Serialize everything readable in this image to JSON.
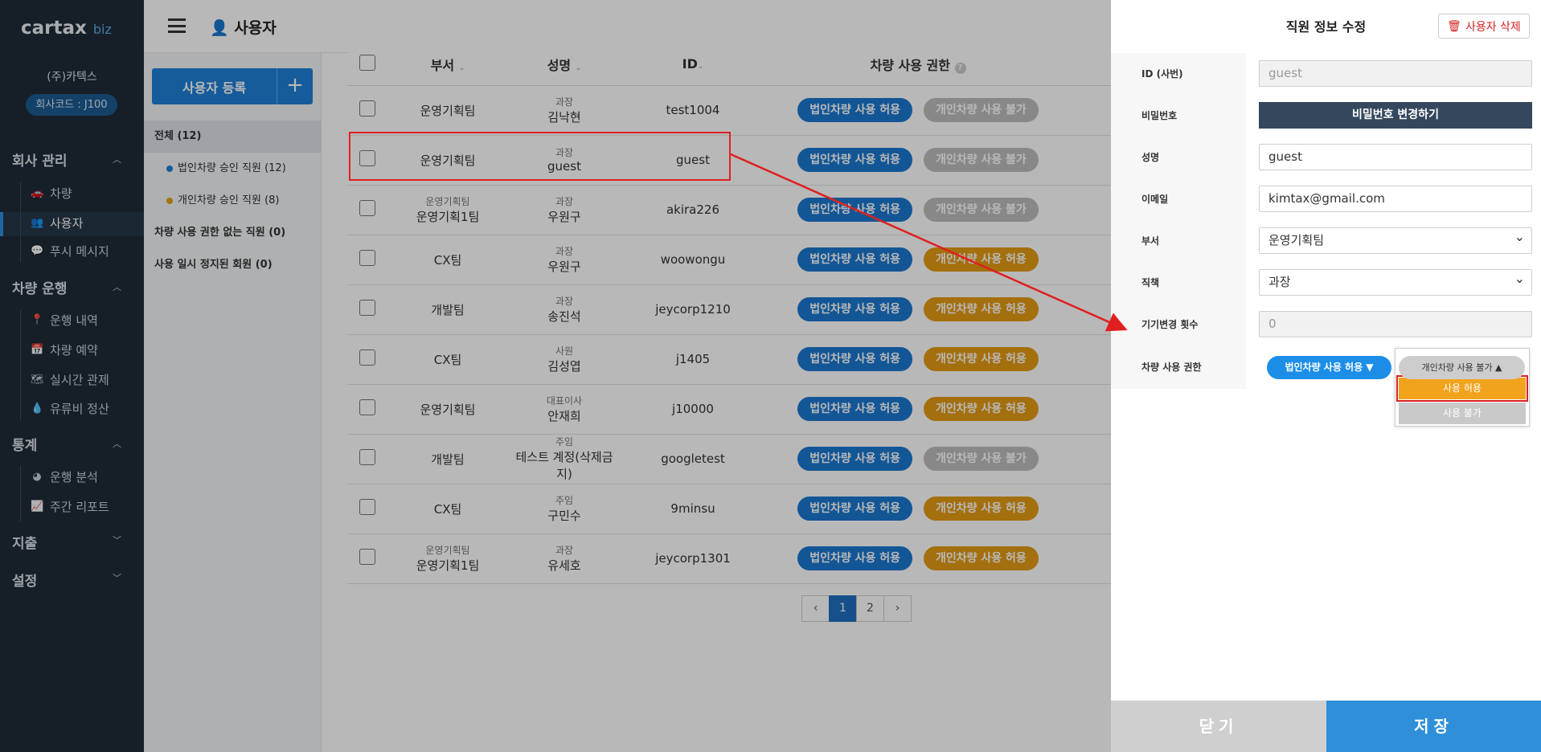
{
  "brand": {
    "logo": "cartax",
    "logo_suffix": "biz",
    "company": "(주)카텍스",
    "company_code": "회사코드 : J100"
  },
  "sidebar": {
    "sections": [
      {
        "label": "회사 관리",
        "items": [
          {
            "label": "차량",
            "icon": "car-icon"
          },
          {
            "label": "사용자",
            "icon": "user-icon"
          },
          {
            "label": "푸시 메시지",
            "icon": "message-icon"
          }
        ]
      },
      {
        "label": "차량 운행",
        "items": [
          {
            "label": "운행 내역",
            "icon": "map-pin-icon"
          },
          {
            "label": "차량 예약",
            "icon": "calendar-icon"
          },
          {
            "label": "실시간 관제",
            "icon": "map-icon"
          },
          {
            "label": "유류비 정산",
            "icon": "fuel-drop-icon"
          }
        ]
      },
      {
        "label": "통계",
        "items": [
          {
            "label": "운행 분석",
            "icon": "pie-chart-icon"
          },
          {
            "label": "주간 리포트",
            "icon": "area-chart-icon"
          }
        ]
      },
      {
        "label": "지출",
        "items": []
      },
      {
        "label": "설정",
        "items": []
      }
    ]
  },
  "header": {
    "title": "사용자"
  },
  "left_panel": {
    "register_button": "사용자 등록",
    "filters": [
      {
        "label": "전체 (12)"
      },
      {
        "label": "법인차량 승인 직원 (12)",
        "dot": "#1f7fd6"
      },
      {
        "label": "개인차량 승인 직원 (8)",
        "dot": "#e3a11a"
      },
      {
        "label": "차량 사용 권한 없는 직원 (0)"
      },
      {
        "label": "사용 일시 정지된 회원 (0)"
      }
    ]
  },
  "table": {
    "columns": [
      "부서",
      "성명",
      "ID",
      "차량 사용 권한"
    ],
    "rows": [
      {
        "dept_top": "",
        "dept": "운영기획팀",
        "title": "과장",
        "name": "김낙현",
        "id": "test1004",
        "corp": "법인차량 사용 허용",
        "personal": "개인차량 사용 불가",
        "personal_status": "gray"
      },
      {
        "dept_top": "",
        "dept": "운영기획팀",
        "title": "과장",
        "name": "guest",
        "id": "guest",
        "corp": "법인차량 사용 허용",
        "personal": "개인차량 사용 불가",
        "personal_status": "gray"
      },
      {
        "dept_top": "운영기획팀",
        "dept": "운영기획1팀",
        "title": "과장",
        "name": "우원구",
        "id": "akira226",
        "corp": "법인차량 사용 허용",
        "personal": "개인차량 사용 불가",
        "personal_status": "gray"
      },
      {
        "dept_top": "",
        "dept": "CX팀",
        "title": "과장",
        "name": "우원구",
        "id": "woowongu",
        "corp": "법인차량 사용 허용",
        "personal": "개인차량 사용 허용",
        "personal_status": "orange"
      },
      {
        "dept_top": "",
        "dept": "개발팀",
        "title": "과장",
        "name": "송진석",
        "id": "jeycorp1210",
        "corp": "법인차량 사용 허용",
        "personal": "개인차량 사용 허용",
        "personal_status": "orange"
      },
      {
        "dept_top": "",
        "dept": "CX팀",
        "title": "사원",
        "name": "김성엽",
        "id": "j1405",
        "corp": "법인차량 사용 허용",
        "personal": "개인차량 사용 허용",
        "personal_status": "orange"
      },
      {
        "dept_top": "",
        "dept": "운영기획팀",
        "title": "대표이사",
        "name": "안재희",
        "id": "j10000",
        "corp": "법인차량 사용 허용",
        "personal": "개인차량 사용 허용",
        "personal_status": "orange"
      },
      {
        "dept_top": "",
        "dept": "개발팀",
        "title": "주임",
        "name": "테스트 계정(삭제금지)",
        "id": "googletest",
        "corp": "법인차량 사용 허용",
        "personal": "개인차량 사용 불가",
        "personal_status": "gray"
      },
      {
        "dept_top": "",
        "dept": "CX팀",
        "title": "주임",
        "name": "구민수",
        "id": "9minsu",
        "corp": "법인차량 사용 허용",
        "personal": "개인차량 사용 허용",
        "personal_status": "orange"
      },
      {
        "dept_top": "운영기획팀",
        "dept": "운영기획1팀",
        "title": "과장",
        "name": "유세호",
        "id": "jeycorp1301",
        "corp": "법인차량 사용 허용",
        "personal": "개인차량 사용 허용",
        "personal_status": "orange"
      }
    ]
  },
  "pagination": {
    "prev": "‹",
    "pages": [
      "1",
      "2"
    ],
    "current": "1",
    "next": "›"
  },
  "drawer": {
    "title": "직원 정보 수정",
    "delete_button": "사용자 삭제",
    "fields": {
      "id_label": "ID (사번)",
      "id_value": "guest",
      "password_label": "비밀번호",
      "password_button": "비밀번호 변경하기",
      "name_label": "성명",
      "name_value": "guest",
      "email_label": "이메일",
      "email_value": "kimtax@gmail.com",
      "dept_label": "부서",
      "dept_value": "운영기획팀",
      "position_label": "직책",
      "position_value": "과장",
      "device_label": "기기변경 횟수",
      "device_value": "0",
      "perm_label": "차량 사용 권한",
      "perm_corp": "법인차량 사용 허용 ▼",
      "perm_personal": "개인차량 사용 불가 ▲",
      "dropdown_options": [
        "사용 허용",
        "사용 불가"
      ]
    },
    "close_button": "닫기",
    "save_button": "저장"
  },
  "colors": {
    "sidebar_bg": "#1f2b38",
    "primary": "#1f7fd6",
    "orange": "#e39a13",
    "gray_pill": "#bdbdbd",
    "highlight": "#e02020"
  }
}
